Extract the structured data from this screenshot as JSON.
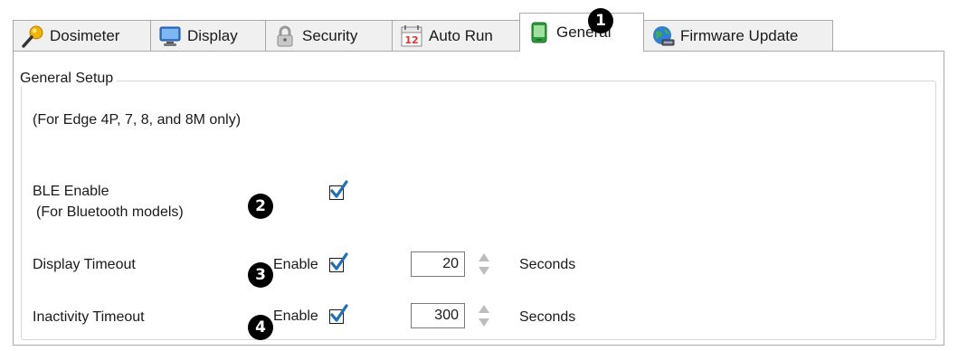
{
  "tabs": [
    {
      "label": "Dosimeter",
      "icon": "dosimeter-icon"
    },
    {
      "label": "Display",
      "icon": "monitor-icon"
    },
    {
      "label": "Security",
      "icon": "padlock-icon"
    },
    {
      "label": "Auto Run",
      "icon": "calendar-icon"
    },
    {
      "label": "General",
      "icon": "device-icon",
      "active": true
    },
    {
      "label": "Firmware Update",
      "icon": "globe-icon"
    }
  ],
  "calendar_day": "12",
  "group": {
    "title": "General Setup",
    "note": "(For Edge 4P, 7, 8, and 8M only)",
    "ble": {
      "label": "BLE Enable",
      "sublabel": "(For Bluetooth models)",
      "checked": true
    },
    "display_timeout": {
      "label": "Display Timeout",
      "enable_label": "Enable",
      "enabled": true,
      "value": "20",
      "unit": "Seconds"
    },
    "inactivity_timeout": {
      "label": "Inactivity Timeout",
      "enable_label": "Enable",
      "enabled": true,
      "value": "300",
      "unit": "Seconds"
    }
  },
  "callouts": [
    "1",
    "2",
    "3",
    "4"
  ],
  "colors": {
    "tab_bg": "#f0f0f0",
    "border": "#a9a9a9",
    "check_blue": "#1e6fb8",
    "badge": "#000000"
  }
}
